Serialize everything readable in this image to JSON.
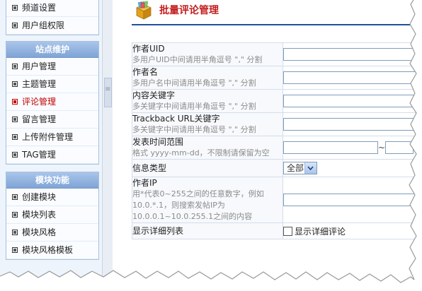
{
  "sidebar": {
    "top_items": [
      {
        "label": "频道设置"
      },
      {
        "label": "用户组权限"
      }
    ],
    "site_maintenance": {
      "header": "站点维护",
      "items": [
        {
          "label": "用户管理",
          "active": false
        },
        {
          "label": "主题管理",
          "active": false
        },
        {
          "label": "评论管理",
          "active": true
        },
        {
          "label": "留言管理",
          "active": false
        },
        {
          "label": "上传附件管理",
          "active": false
        },
        {
          "label": "TAG管理",
          "active": false
        }
      ]
    },
    "modules": {
      "header": "模块功能",
      "items": [
        {
          "label": "创建模块"
        },
        {
          "label": "模块列表"
        },
        {
          "label": "模块风格"
        },
        {
          "label": "模块风格模板"
        }
      ]
    }
  },
  "main": {
    "title": "批量评论管理",
    "fields": {
      "author_uid": {
        "label": "作者UID",
        "hint": "多用户UID中间请用半角逗号 \",\" 分割",
        "value": ""
      },
      "author_name": {
        "label": "作者名",
        "hint": "多用户名中间请用半角逗号 \",\" 分割",
        "value": ""
      },
      "content_keyword": {
        "label": "内容关键字",
        "hint": "多关键字中间请用半角逗号 \",\" 分割",
        "value": ""
      },
      "trackback_keyword": {
        "label": "Trackback URL关键字",
        "hint": "多关键字中间请用半角逗号 \",\" 分割",
        "value": ""
      },
      "date_range": {
        "label": "发表时间范围",
        "hint": "格式 yyyy-mm-dd，不限制请保留为空",
        "from": "",
        "to": "",
        "separator": "~"
      },
      "info_type": {
        "label": "信息类型",
        "selected": "全部"
      },
      "author_ip": {
        "label": "作者IP",
        "hint": "用*代表0~255之间的任意数字，例如10.0.*.1，则搜索发帖IP为10.0.0.1~10.0.255.1之间的内容",
        "value": ""
      },
      "detail_list": {
        "label": "显示详细列表",
        "checkbox_label": "显示详细评论",
        "checked": false
      }
    }
  },
  "colors": {
    "title": "#c41d1d",
    "rule": "#21509a",
    "active_item": "#c00000"
  }
}
